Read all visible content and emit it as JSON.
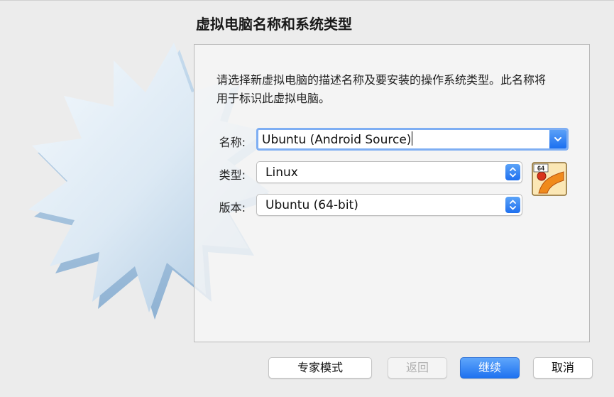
{
  "dialog": {
    "title": "虚拟电脑名称和系统类型",
    "description": "请选择新虚拟电脑的描述名称及要安装的操作系统类型。此名称将用于标识此虚拟电脑。"
  },
  "form": {
    "name_label": "名称:",
    "name_value": "Ubuntu (Android Source)",
    "type_label": "类型:",
    "type_value": "Linux",
    "version_label": "版本:",
    "version_value": "Ubuntu (64-bit)",
    "os_icon_badge": "64"
  },
  "buttons": {
    "expert_mode": "专家模式",
    "back": "返回",
    "continue": "继续",
    "cancel": "取消"
  },
  "colors": {
    "accent": "#1e72f0",
    "focus_ring": "#7eaef3"
  },
  "icons": {
    "name_dropdown": "chevron-down-icon",
    "stepper": "up-down-stepper-icon",
    "os": "ubuntu-64-icon"
  }
}
